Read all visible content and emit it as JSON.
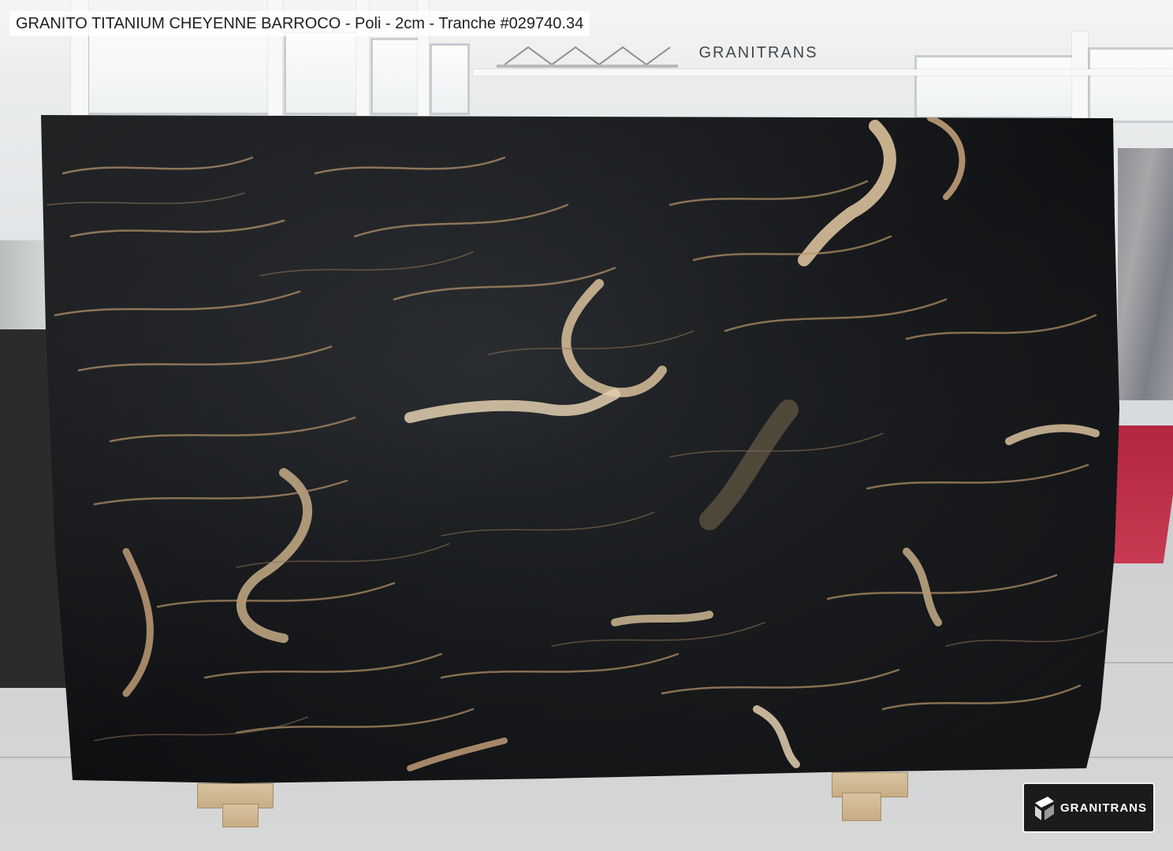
{
  "caption": {
    "text": "GRANITO TITANIUM CHEYENNE BARROCO - Poli - 2cm - Tranche #029740.34"
  },
  "ceiling_sign": {
    "text": "GRANITRANS"
  },
  "brand_logo": {
    "text": "GRANITRANS"
  },
  "colors": {
    "slab_base": "#15171a",
    "vein_gold": "#c9a37a",
    "vein_cream": "#e2cfae",
    "carpet_red": "#c0314a",
    "logo_bg": "#1b1b1b"
  }
}
